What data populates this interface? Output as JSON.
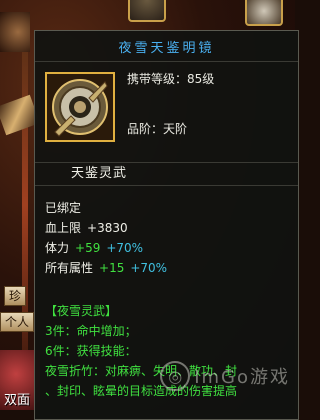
{
  "item": {
    "title": "夜雪天鉴明镜",
    "carry_level_label": "携带等级：",
    "carry_level_value": "85级",
    "grade_label": "品阶：",
    "grade_value": "天阶",
    "section_name": "天鉴灵武",
    "icon": "mirror-icon"
  },
  "stats": {
    "bound": "已绑定",
    "hp_label": "血上限",
    "hp_value": "+3830",
    "stamina_label": "体力",
    "stamina_flat": "+59",
    "stamina_pct": "+70%",
    "allattr_label": "所有属性",
    "allattr_flat": "+15",
    "allattr_pct": "+70%"
  },
  "set": {
    "name": "【夜雪灵武】",
    "line3": "3件：命中增加；",
    "line6": "6件：获得技能：",
    "line_skill": "夜雪折竹：对麻痹、失明、散功、封",
    "line_skill_cont": "、封印、眩晕的目标造成的伤害提高"
  },
  "side": {
    "btn1": "珍",
    "btn2": "个人",
    "bottom_label": "双面"
  },
  "watermark": "ImGo游戏"
}
